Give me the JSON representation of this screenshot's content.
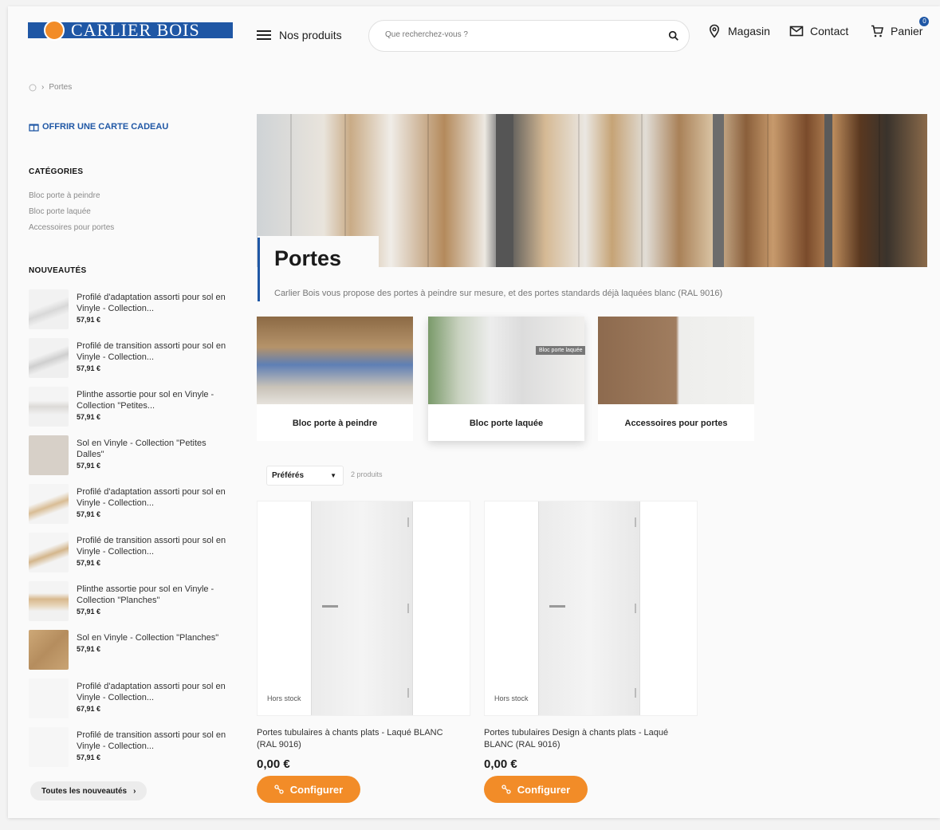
{
  "header": {
    "logo_text": "CARLIER BOIS",
    "menu_label": "Nos produits",
    "search_placeholder": "Que recherchez-vous ?",
    "store_label": "Magasin",
    "contact_label": "Contact",
    "cart_label": "Panier",
    "cart_count": "0"
  },
  "breadcrumb": {
    "current": "Portes"
  },
  "sidebar": {
    "gift_label": "OFFRIR UNE CARTE CADEAU",
    "categories_title": "CATÉGORIES",
    "categories": [
      "Bloc porte à peindre",
      "Bloc porte laquée",
      "Accessoires pour portes"
    ],
    "news_title": "NOUVEAUTÉS",
    "news": [
      {
        "name": "Profilé d'adaptation assorti pour sol en Vinyle - Collection...",
        "price": "57,91 €"
      },
      {
        "name": "Profilé de transition assorti pour sol en Vinyle - Collection...",
        "price": "57,91 €"
      },
      {
        "name": "Plinthe assortie pour sol en Vinyle - Collection \"Petites...",
        "price": "57,91 €"
      },
      {
        "name": "Sol en Vinyle - Collection \"Petites Dalles\"",
        "price": "57,91 €"
      },
      {
        "name": "Profilé d'adaptation assorti pour sol en Vinyle - Collection...",
        "price": "57,91 €"
      },
      {
        "name": "Profilé de transition assorti pour sol en Vinyle - Collection...",
        "price": "57,91 €"
      },
      {
        "name": "Plinthe assortie pour sol en Vinyle - Collection \"Planches\"",
        "price": "57,91 €"
      },
      {
        "name": "Sol en Vinyle - Collection \"Planches\"",
        "price": "57,91 €"
      },
      {
        "name": "Profilé d'adaptation assorti pour sol en Vinyle - Collection...",
        "price": "67,91 €"
      },
      {
        "name": "Profilé de transition assorti pour sol en Vinyle - Collection...",
        "price": "57,91 €"
      }
    ],
    "all_news_label": "Toutes les nouveautés"
  },
  "hero": {
    "title": "Portes",
    "description": "Carlier Bois vous propose des portes à peindre sur mesure, et des portes standards déjà laquées blanc (RAL 9016)"
  },
  "category_cards": [
    {
      "label": "Bloc porte à peindre"
    },
    {
      "label": "Bloc porte laquée",
      "tooltip": "Bloc porte laquée"
    },
    {
      "label": "Accessoires pour portes"
    }
  ],
  "listing": {
    "sort_label": "Préférés",
    "count_label": "2 produits"
  },
  "products": [
    {
      "name": "Portes tubulaires à chants plats - Laqué BLANC (RAL 9016)",
      "price": "0,00 €",
      "stock": "Hors stock",
      "button": "Configurer"
    },
    {
      "name": "Portes tubulaires Design à chants plats - Laqué BLANC (RAL 9016)",
      "price": "0,00 €",
      "stock": "Hors stock",
      "button": "Configurer"
    }
  ],
  "colors": {
    "brand_blue": "#1f57a5",
    "accent_orange": "#f28c28"
  }
}
